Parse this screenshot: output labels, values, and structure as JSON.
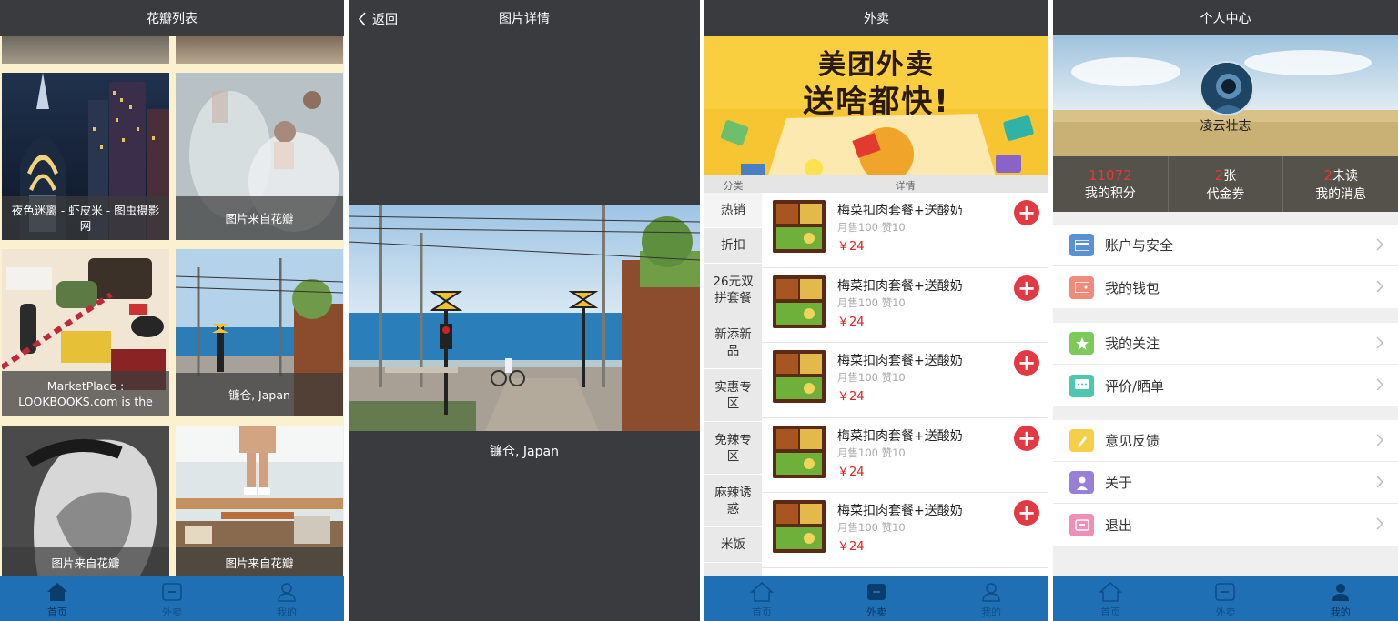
{
  "colors": {
    "topbar": "#3a3b3f",
    "tabbar": "#1f6fb5",
    "accent_red": "#e02020",
    "banner_yellow": "#f7c531"
  },
  "huaban": {
    "title": "花瓣列表",
    "tiles": [
      {
        "caption": "夜色迷离 - 虾皮米 - 图虫摄影网"
      },
      {
        "caption": "图片来自花瓣"
      },
      {
        "caption": "MarketPlace : LOOKBOOKS.com is the"
      },
      {
        "caption": "镰仓, Japan"
      },
      {
        "caption": "图片来自花瓣"
      },
      {
        "caption": "图片来自花瓣"
      }
    ],
    "tabs": [
      {
        "label": "首页",
        "icon": "home-icon"
      },
      {
        "label": "外卖",
        "icon": "takeout-icon"
      },
      {
        "label": "我的",
        "icon": "user-icon"
      }
    ]
  },
  "detail": {
    "back_label": "返回",
    "title": "图片详情",
    "caption": "镰仓, Japan"
  },
  "takeout": {
    "title": "外卖",
    "banner_line1": "美团外卖",
    "banner_line2": "送啥都快!",
    "col_category": "分类",
    "col_detail": "详情",
    "categories": [
      "热销",
      "折扣",
      "26元双拼套餐",
      "新添新品",
      "实惠专区",
      "免辣专区",
      "麻辣诱惑",
      "米饭"
    ],
    "foods": [
      {
        "name": "梅菜扣肉套餐+送酸奶",
        "meta": "月售100 赞10",
        "price": "￥24"
      },
      {
        "name": "梅菜扣肉套餐+送酸奶",
        "meta": "月售100 赞10",
        "price": "￥24"
      },
      {
        "name": "梅菜扣肉套餐+送酸奶",
        "meta": "月售100 赞10",
        "price": "￥24"
      },
      {
        "name": "梅菜扣肉套餐+送酸奶",
        "meta": "月售100 赞10",
        "price": "￥24"
      },
      {
        "name": "梅菜扣肉套餐+送酸奶",
        "meta": "月售100 赞10",
        "price": "￥24"
      }
    ],
    "tabs": [
      {
        "label": "首页",
        "icon": "home-icon"
      },
      {
        "label": "外卖",
        "icon": "takeout-icon"
      },
      {
        "label": "我的",
        "icon": "user-icon"
      }
    ]
  },
  "profile": {
    "title": "个人中心",
    "username": "凌云壮志",
    "stats": [
      {
        "value": "11072",
        "label": "我的积分",
        "unit": ""
      },
      {
        "value": "2",
        "label": "代金券",
        "unit": "张"
      },
      {
        "value": "2",
        "label": "我的消息",
        "unit": "未读"
      }
    ],
    "menu": [
      {
        "label": "账户与安全",
        "icon": "account-icon",
        "color": "#5b8fd6"
      },
      {
        "label": "我的钱包",
        "icon": "wallet-icon",
        "color": "#f08a7a"
      },
      {
        "label": "我的关注",
        "icon": "star-icon",
        "color": "#7dc95a"
      },
      {
        "label": "评价/晒单",
        "icon": "comment-icon",
        "color": "#4fc7b0"
      },
      {
        "label": "意见反馈",
        "icon": "feedback-icon",
        "color": "#f5cf4a"
      },
      {
        "label": "关于",
        "icon": "about-icon",
        "color": "#9a7fd6"
      },
      {
        "label": "退出",
        "icon": "logout-icon",
        "color": "#ef8fb7"
      }
    ],
    "tabs": [
      {
        "label": "首页",
        "icon": "home-icon"
      },
      {
        "label": "外卖",
        "icon": "takeout-icon"
      },
      {
        "label": "我的",
        "icon": "user-icon"
      }
    ]
  }
}
